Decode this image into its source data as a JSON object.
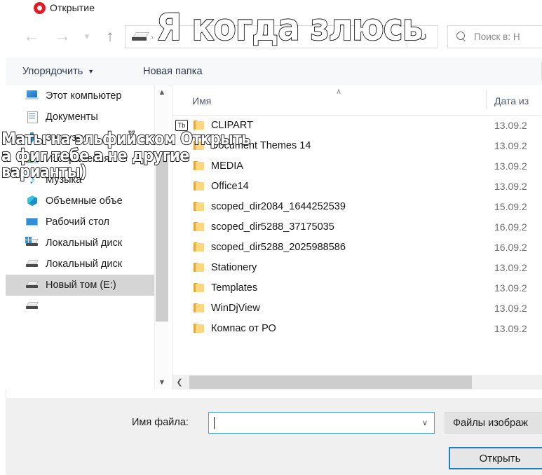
{
  "window": {
    "title": "Открытие",
    "app_icon": "opera-icon"
  },
  "nav": {
    "back_icon": "arrow-left-icon",
    "forward_icon": "arrow-right-icon",
    "history_icon": "chevron-down-icon",
    "up_icon": "arrow-up-icon",
    "refresh_icon": "refresh-icon",
    "address": {
      "drive_icon": "drive-icon",
      "separator": "›",
      "crumb": ""
    },
    "search": {
      "icon": "search-icon",
      "placeholder": "Поиск в: Н"
    }
  },
  "command_bar": {
    "organize": "Упорядочить",
    "organize_caret": "▼",
    "new_folder": "Новая папка"
  },
  "sidebar": {
    "scroll_up_icon": "chevron-up-icon",
    "scroll_down_icon": "chevron-down-icon",
    "items": [
      {
        "label": "Этот компьютер",
        "icon": "computer-icon",
        "selected": false
      },
      {
        "label": "Документы",
        "icon": "documents-icon",
        "selected": false
      },
      {
        "label": "Загрузки",
        "icon": "downloads-icon",
        "selected": false
      },
      {
        "label": "Изображения",
        "icon": "pictures-icon",
        "selected": false
      },
      {
        "label": "Музыка",
        "icon": "music-icon",
        "selected": false
      },
      {
        "label": "Объемные объе",
        "icon": "3d-objects-icon",
        "selected": false
      },
      {
        "label": "Рабочий стол",
        "icon": "desktop-icon",
        "selected": false
      },
      {
        "label": "Локальный диск",
        "icon": "system-drive-icon",
        "selected": false
      },
      {
        "label": "Локальный диск",
        "icon": "drive-icon",
        "selected": false
      },
      {
        "label": "Новый том (E:)",
        "icon": "drive-icon",
        "selected": true
      }
    ]
  },
  "file_pane": {
    "columns": {
      "name": "Имя",
      "date_modified": "Дата из",
      "sort_caret": "∧"
    },
    "rows": [
      {
        "name": "CLIPART",
        "date": "13.09.2",
        "icon": "folder-icon",
        "badge": "Тb"
      },
      {
        "name": "Document Themes 14",
        "date": "13.09.2",
        "icon": "folder-icon"
      },
      {
        "name": "MEDIA",
        "date": "13.09.2",
        "icon": "folder-icon"
      },
      {
        "name": "Office14",
        "date": "13.09.2",
        "icon": "folder-icon"
      },
      {
        "name": "scoped_dir2084_1644252539",
        "date": "15.09.2",
        "icon": "folder-icon"
      },
      {
        "name": "scoped_dir5288_37175035",
        "date": "16.09.2",
        "icon": "folder-icon"
      },
      {
        "name": "scoped_dir5288_2025988586",
        "date": "16.09.2",
        "icon": "folder-icon"
      },
      {
        "name": "Stationery",
        "date": "13.09.2",
        "icon": "folder-icon"
      },
      {
        "name": "Templates",
        "date": "13.09.2",
        "icon": "folder-icon"
      },
      {
        "name": "WinDjView",
        "date": "13.09.2",
        "icon": "folder-icon"
      },
      {
        "name": "Компас от РО",
        "date": "13.09.2",
        "icon": "folder-icon"
      }
    ],
    "hscroll_left_icon": "chevron-left-icon"
  },
  "footer": {
    "file_name_label": "Имя файла:",
    "file_name_value": "",
    "file_name_caret": "∨",
    "filter_value": "Файлы изображ",
    "open_button": "Открыть"
  },
  "overlay": {
    "top_text": "Я когда злюсь",
    "left_line1": "Маты на эльфийском Открыть",
    "left_line2": "а фиг тебе а не другие",
    "left_line3": "варианты)"
  },
  "colors": {
    "accent_blue": "#1a7fc1",
    "folder_yellow": "#fcd77f",
    "selection_gray": "#d5d5d5",
    "opera_red": "#e31b23"
  }
}
